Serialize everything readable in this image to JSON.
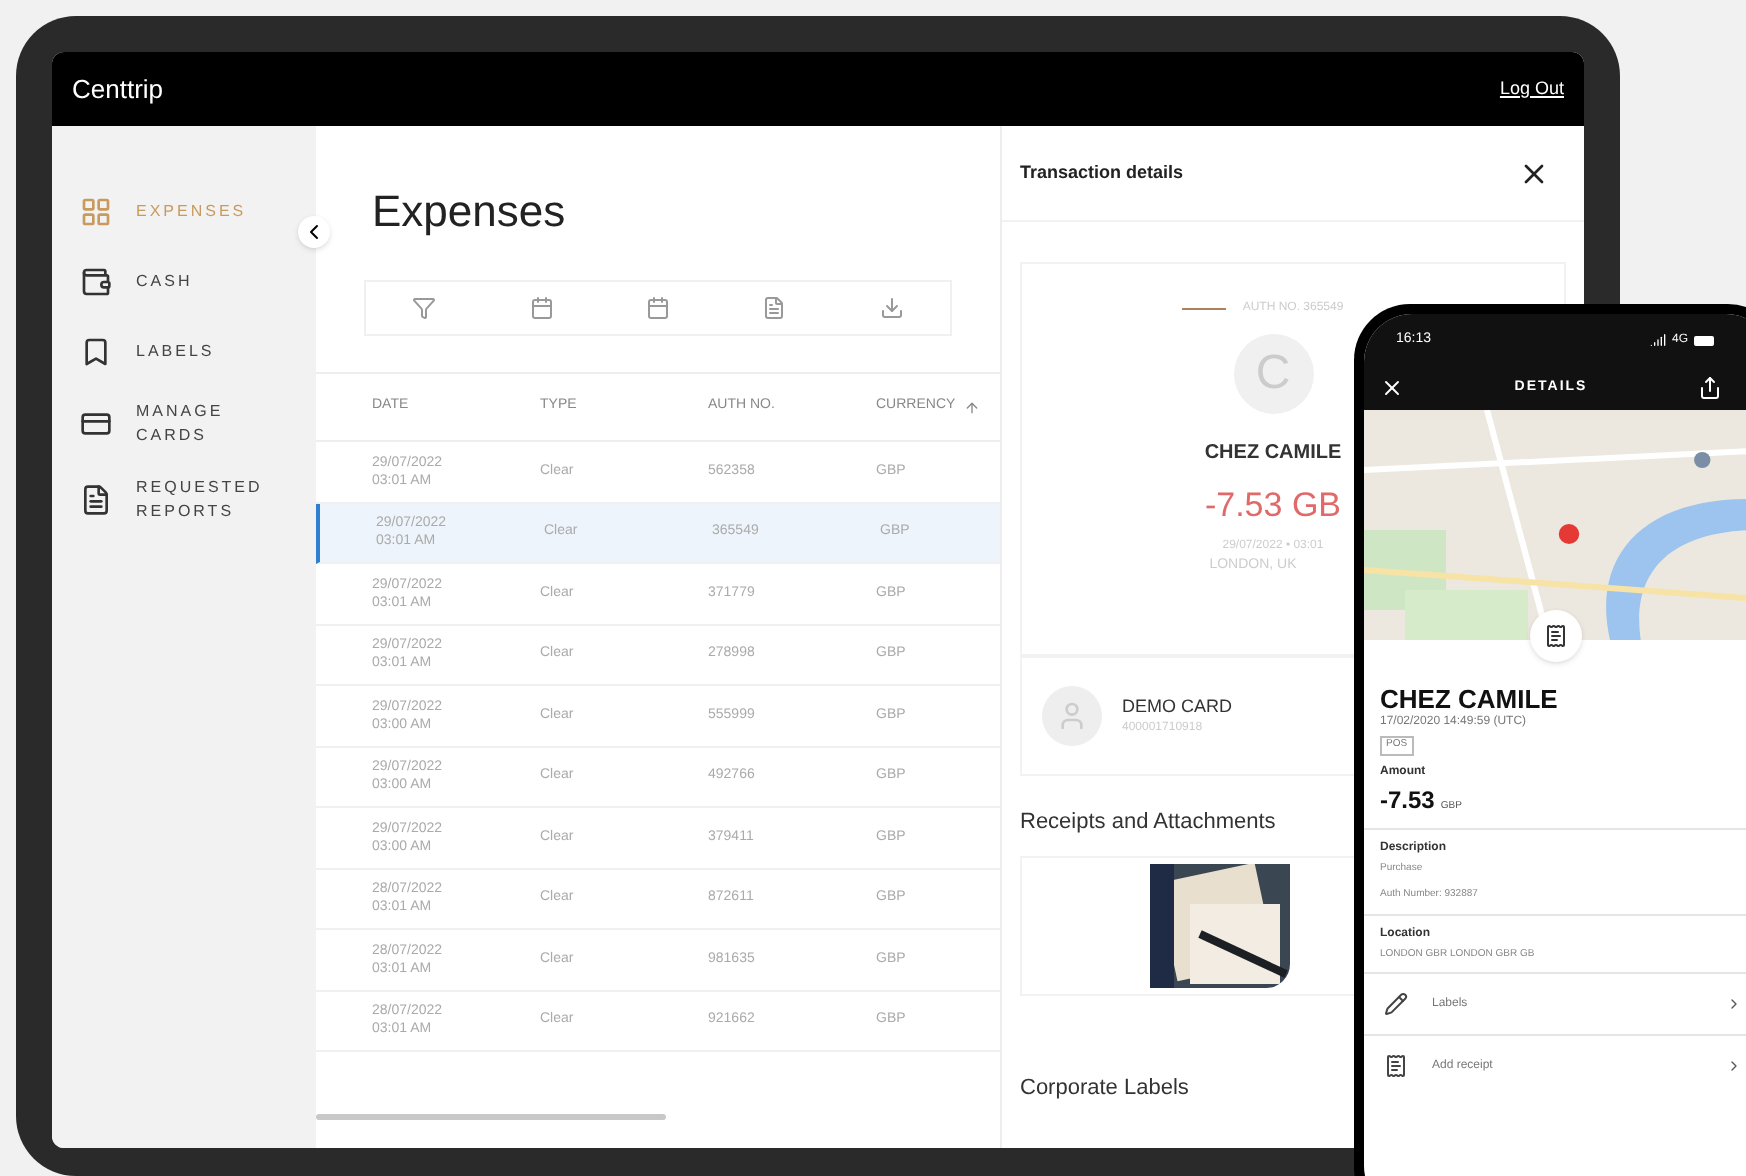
{
  "tablet": {
    "brand": "Centtrip",
    "logout": "Log Out",
    "sidebar": {
      "items": [
        {
          "label": "EXPENSES",
          "selected": true
        },
        {
          "label": "CASH",
          "selected": false
        },
        {
          "label": "LABELS",
          "selected": false
        },
        {
          "label": "MANAGE CARDS",
          "selected": false
        },
        {
          "label": "REQUESTED REPORTS",
          "selected": false
        }
      ]
    },
    "page_title": "Expenses",
    "table": {
      "columns": [
        "DATE",
        "TYPE",
        "AUTH NO.",
        "CURRENCY"
      ],
      "rows": [
        {
          "date": "29/07/2022",
          "time": "03:01 AM",
          "type": "Clear",
          "auth": "562358",
          "currency": "GBP",
          "selected": false
        },
        {
          "date": "29/07/2022",
          "time": "03:01 AM",
          "type": "Clear",
          "auth": "365549",
          "currency": "GBP",
          "selected": true
        },
        {
          "date": "29/07/2022",
          "time": "03:01 AM",
          "type": "Clear",
          "auth": "371779",
          "currency": "GBP",
          "selected": false
        },
        {
          "date": "29/07/2022",
          "time": "03:01 AM",
          "type": "Clear",
          "auth": "278998",
          "currency": "GBP",
          "selected": false
        },
        {
          "date": "29/07/2022",
          "time": "03:00 AM",
          "type": "Clear",
          "auth": "555999",
          "currency": "GBP",
          "selected": false
        },
        {
          "date": "29/07/2022",
          "time": "03:00 AM",
          "type": "Clear",
          "auth": "492766",
          "currency": "GBP",
          "selected": false
        },
        {
          "date": "29/07/2022",
          "time": "03:00 AM",
          "type": "Clear",
          "auth": "379411",
          "currency": "GBP",
          "selected": false
        },
        {
          "date": "28/07/2022",
          "time": "03:01 AM",
          "type": "Clear",
          "auth": "872611",
          "currency": "GBP",
          "selected": false
        },
        {
          "date": "28/07/2022",
          "time": "03:01 AM",
          "type": "Clear",
          "auth": "981635",
          "currency": "GBP",
          "selected": false
        },
        {
          "date": "28/07/2022",
          "time": "03:01 AM",
          "type": "Clear",
          "auth": "921662",
          "currency": "GBP",
          "selected": false
        }
      ]
    },
    "details": {
      "title": "Transaction details",
      "auth": "AUTH NO. 365549",
      "avatar": "C",
      "merchant": "CHEZ CAMILE",
      "amount": "-7.53 GB",
      "date": "29/07/2022 • 03:01",
      "location": "LONDON, UK",
      "card_name": "DEMO CARD",
      "card_number": "400001710918",
      "receipts_title": "Receipts and Attachments",
      "labels_title": "Corporate Labels"
    }
  },
  "phone": {
    "time": "16:13",
    "network": "4G",
    "title": "DETAILS",
    "merchant": "CHEZ CAMILE",
    "datetime": "17/02/2020 14:49:59 (UTC)",
    "tag": "POS",
    "amount_label": "Amount",
    "amount": "-7.53",
    "currency": "GBP",
    "description_label": "Description",
    "description": "Purchase",
    "auth": "Auth Number: 932887",
    "location_label": "Location",
    "location": "LONDON GBR LONDON GBR GB",
    "actions": [
      {
        "label": "Labels"
      },
      {
        "label": "Add receipt"
      }
    ]
  }
}
